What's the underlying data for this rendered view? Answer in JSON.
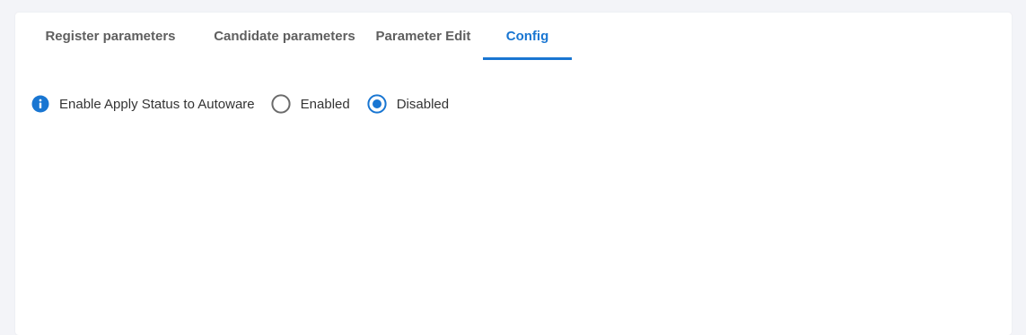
{
  "tabs": [
    {
      "label": "Register parameters",
      "active": false
    },
    {
      "label": "Candidate parameters",
      "active": false
    },
    {
      "label": "Parameter Edit",
      "active": false
    },
    {
      "label": "Config",
      "active": true
    }
  ],
  "config": {
    "setting_label": "Enable Apply Status to Autoware",
    "info_icon": "info-icon",
    "options": [
      {
        "label": "Enabled",
        "selected": false
      },
      {
        "label": "Disabled",
        "selected": true
      }
    ]
  },
  "colors": {
    "accent": "#1976d2",
    "tab_text": "#5f5f5f",
    "page_bg": "#f3f4f8",
    "radio_unselected": "#6b6b6b"
  }
}
